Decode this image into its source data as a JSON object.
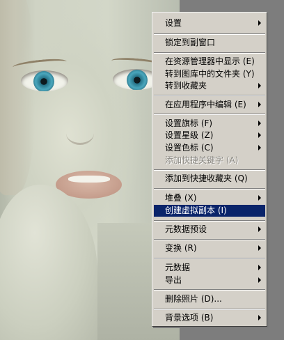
{
  "menu": {
    "items": [
      {
        "label": "设置",
        "submenu": true
      },
      {
        "label": "锁定到副窗口"
      },
      {
        "label": "在资源管理器中显示 (E)"
      },
      {
        "label": "转到图库中的文件夹 (Y)"
      },
      {
        "label": "转到收藏夹",
        "submenu": true
      },
      {
        "label": "在应用程序中编辑 (E)",
        "submenu": true
      },
      {
        "label": "设置旗标 (F)",
        "submenu": true
      },
      {
        "label": "设置星级 (Z)",
        "submenu": true
      },
      {
        "label": "设置色标 (C)",
        "submenu": true
      },
      {
        "label": "添加快捷关键字 (A)",
        "disabled": true
      },
      {
        "label": "添加到快捷收藏夹 (Q)"
      },
      {
        "label": "堆叠 (X)",
        "submenu": true
      },
      {
        "label": "创建虚拟副本 (I)",
        "highlighted": true
      },
      {
        "label": "元数据预设",
        "submenu": true
      },
      {
        "label": "变换 (R)",
        "submenu": true
      },
      {
        "label": "元数据",
        "submenu": true
      },
      {
        "label": "导出",
        "submenu": true
      },
      {
        "label": "删除照片 (D)..."
      },
      {
        "label": "背景选项 (B)",
        "submenu": true
      }
    ]
  },
  "colors": {
    "menu_bg": "#d4d0c8",
    "highlight_bg": "#0a246a",
    "highlight_text": "#ffffff",
    "disabled_text": "#8c8a84",
    "eye_iris": "#4aa7bd"
  }
}
